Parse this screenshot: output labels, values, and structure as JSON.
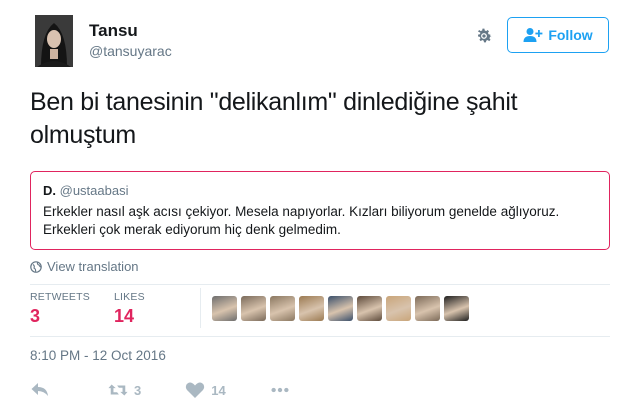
{
  "user": {
    "name": "Tansu",
    "handle": "@tansuyarac"
  },
  "follow_button": {
    "label": "Follow",
    "icon": "add-user-icon",
    "color": "#1da1f2"
  },
  "settings_icon": "gear-icon",
  "tweet": {
    "text_line1": "Ben bi tanesinin \"delikanlım\" dinlediğine şahit",
    "text_line2": "olmuştum"
  },
  "quoted_tweet": {
    "author": "D.",
    "handle": "@ustaabasi",
    "line1": "Erkekler nasıl aşk acısı çekiyor. Mesela napıyorlar. Kızları biliyorum genelde ağlıyoruz.",
    "line2": "Erkekleri çok merak ediyorum hiç denk gelmedim.",
    "border_color": "#e0245e"
  },
  "translation": {
    "label": "View translation",
    "icon": "globe-icon"
  },
  "stats": {
    "retweets_label": "RETWEETS",
    "retweets_value": "3",
    "likes_label": "LIKES",
    "likes_value": "14",
    "accent_color": "#e0245e"
  },
  "likers": [
    {
      "name": "liker-avatar-1",
      "color": "#6d6d6d"
    },
    {
      "name": "liker-avatar-2",
      "color": "#7a6a5a"
    },
    {
      "name": "liker-avatar-3",
      "color": "#8a7760"
    },
    {
      "name": "liker-avatar-4",
      "color": "#9b7a52"
    },
    {
      "name": "liker-avatar-5",
      "color": "#3a4f6b"
    },
    {
      "name": "liker-avatar-6",
      "color": "#5d4a3b"
    },
    {
      "name": "liker-avatar-7",
      "color": "#c9a57a"
    },
    {
      "name": "liker-avatar-8",
      "color": "#7c6a58"
    },
    {
      "name": "liker-avatar-9",
      "color": "#1f1f1f"
    }
  ],
  "timestamp": "8:10 PM - 12 Oct 2016",
  "actions": {
    "reply_icon": "reply-icon",
    "retweet_icon": "retweet-icon",
    "retweet_count": "3",
    "like_icon": "heart-icon",
    "like_count": "14",
    "more_icon": "more-icon"
  }
}
